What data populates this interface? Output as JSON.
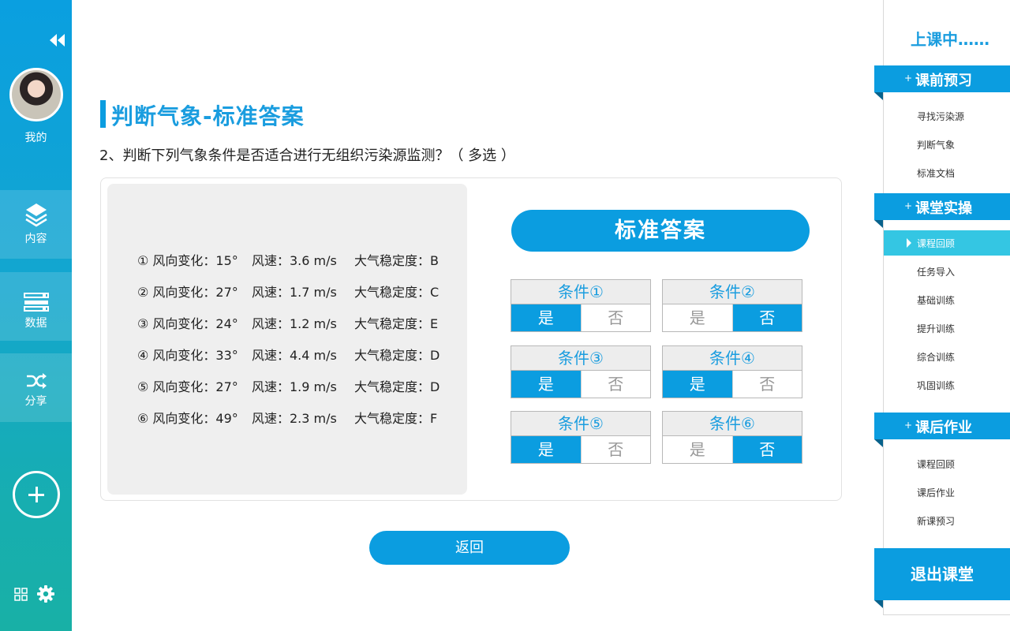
{
  "left_sidebar": {
    "profile_label": "我的",
    "nav": [
      {
        "label": "内容",
        "icon": "layers-icon"
      },
      {
        "label": "数据",
        "icon": "database-icon"
      },
      {
        "label": "分享",
        "icon": "shuffle-icon"
      }
    ],
    "icons": [
      "collapse-icon",
      "plus-icon",
      "grid-icon",
      "gear-icon"
    ]
  },
  "main": {
    "title": "判断气象-标准答案",
    "question": "2、判断下列气象条件是否适合进行无组织污染源监测？（ 多选 ）",
    "conditions": [
      {
        "wind_dir": "① 风向变化：15°",
        "wind_speed": "风速：3.6 m/s",
        "stability": "大气稳定度：B"
      },
      {
        "wind_dir": "② 风向变化：27°",
        "wind_speed": "风速：1.7 m/s",
        "stability": "大气稳定度：C"
      },
      {
        "wind_dir": "③ 风向变化：24°",
        "wind_speed": "风速：1.2 m/s",
        "stability": "大气稳定度：E"
      },
      {
        "wind_dir": "④ 风向变化：33°",
        "wind_speed": "风速：4.4 m/s",
        "stability": "大气稳定度：D"
      },
      {
        "wind_dir": "⑤ 风向变化：27°",
        "wind_speed": "风速：1.9 m/s",
        "stability": "大气稳定度：D"
      },
      {
        "wind_dir": "⑥ 风向变化：49°",
        "wind_speed": "风速：2.3 m/s",
        "stability": "大气稳定度：F"
      }
    ],
    "answer_title": "标准答案",
    "yes_label": "是",
    "no_label": "否",
    "answers": [
      {
        "label": "条件①",
        "selected": "yes"
      },
      {
        "label": "条件②",
        "selected": "no"
      },
      {
        "label": "条件③",
        "selected": "yes"
      },
      {
        "label": "条件④",
        "selected": "yes"
      },
      {
        "label": "条件⑤",
        "selected": "yes"
      },
      {
        "label": "条件⑥",
        "selected": "no"
      }
    ],
    "back_button": "返回"
  },
  "right_sidebar": {
    "status": "上课中……",
    "sections": [
      {
        "title": "课前预习",
        "items": [
          "寻找污染源",
          "判断气象",
          "标准文档"
        ]
      },
      {
        "title": "课堂实操",
        "items": [
          "课程回顾",
          "任务导入",
          "基础训练",
          "提升训练",
          "综合训练",
          "巩固训练"
        ]
      },
      {
        "title": "课后作业",
        "items": [
          "课程回顾",
          "课后作业",
          "新课预习"
        ]
      }
    ],
    "active_item": "课程回顾",
    "exit_button": "退出课堂"
  },
  "colors": {
    "accent": "#0b9de0",
    "active_menu": "#34c6e3",
    "sidebar_top": "#0a9fe0",
    "sidebar_bottom": "#18b0a6"
  }
}
